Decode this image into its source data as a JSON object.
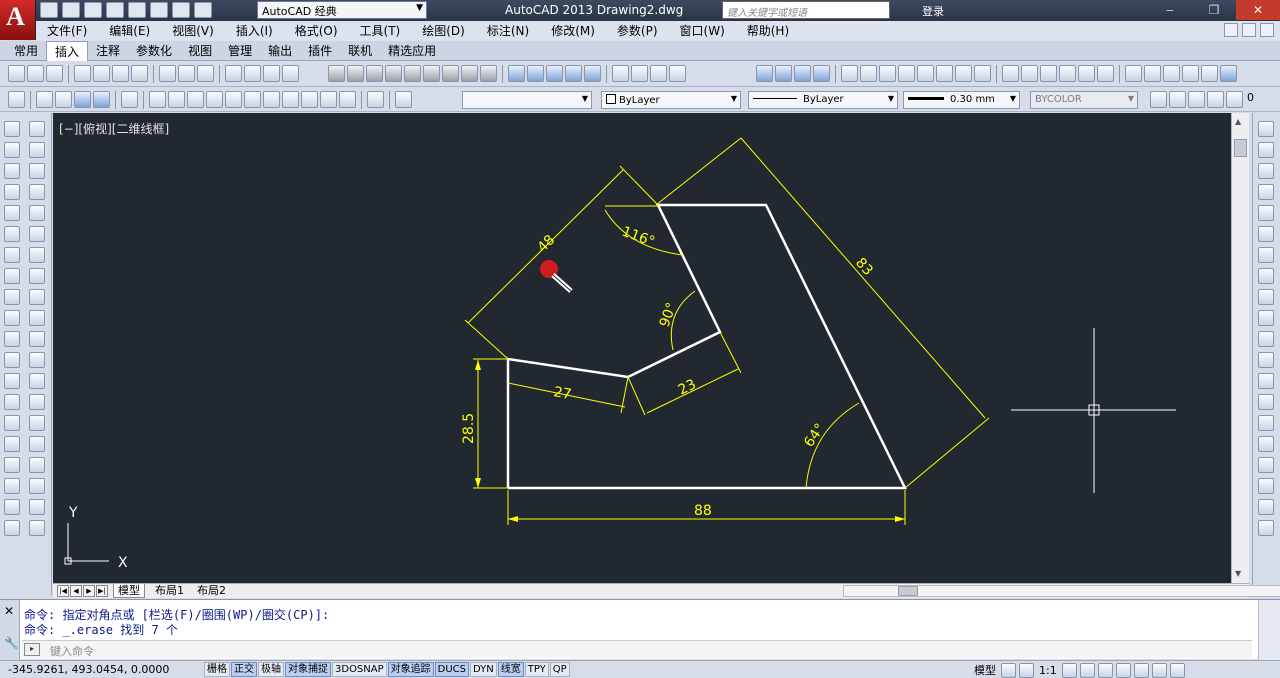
{
  "titlebar": {
    "logo_letter": "A",
    "workspace": "AutoCAD 经典",
    "app_title": "AutoCAD 2013    Drawing2.dwg",
    "search_placeholder": "键入关键字或短语",
    "login": "登录"
  },
  "menu": [
    "文件(F)",
    "编辑(E)",
    "视图(V)",
    "插入(I)",
    "格式(O)",
    "工具(T)",
    "绘图(D)",
    "标注(N)",
    "修改(M)",
    "参数(P)",
    "窗口(W)",
    "帮助(H)"
  ],
  "ribbon_tabs": [
    "常用",
    "插入",
    "注释",
    "参数化",
    "视图",
    "管理",
    "输出",
    "插件",
    "联机",
    "精选应用"
  ],
  "ribbon_active_index": 1,
  "properties": {
    "color": "ByLayer",
    "linetype": "ByLayer",
    "lineweight": "0.30 mm",
    "plotstyle": "BYCOLOR",
    "layer_value": "0"
  },
  "viewport": {
    "label": "[−][俯视][二维线框]",
    "ucs_y": "Y",
    "ucs_x": "X",
    "dimensions": {
      "d48": "48",
      "d83": "83",
      "d116": "116°",
      "d90": "90°",
      "d27": "27",
      "d23": "23",
      "d28_5": "28.5",
      "d64": "64°",
      "d88": "88"
    }
  },
  "layout_tabs": [
    "模型",
    "布局1",
    "布局2"
  ],
  "command": {
    "line1": "命令: 指定对角点或 [栏选(F)/圈围(WP)/圈交(CP)]:",
    "line2": "命令: _.erase 找到 7 个",
    "placeholder": "键入命令"
  },
  "status": {
    "coords": "-345.9261, 493.0454, 0.0000",
    "buttons": [
      {
        "label": "栅格",
        "on": false
      },
      {
        "label": "正交",
        "on": true
      },
      {
        "label": "极轴",
        "on": false
      },
      {
        "label": "对象捕捉",
        "on": true
      },
      {
        "label": "3DOSNAP",
        "on": false
      },
      {
        "label": "对象追踪",
        "on": true
      },
      {
        "label": "DUCS",
        "on": true
      },
      {
        "label": "DYN",
        "on": false
      },
      {
        "label": "线宽",
        "on": true
      },
      {
        "label": "TPY",
        "on": false
      },
      {
        "label": "QP",
        "on": false
      }
    ],
    "model_label": "模型",
    "scale": "1:1"
  },
  "colors": {
    "canvas": "#212830",
    "geometry": "#ffffff",
    "dimension": "#ffff00",
    "accent_red": "#d01c1c"
  }
}
